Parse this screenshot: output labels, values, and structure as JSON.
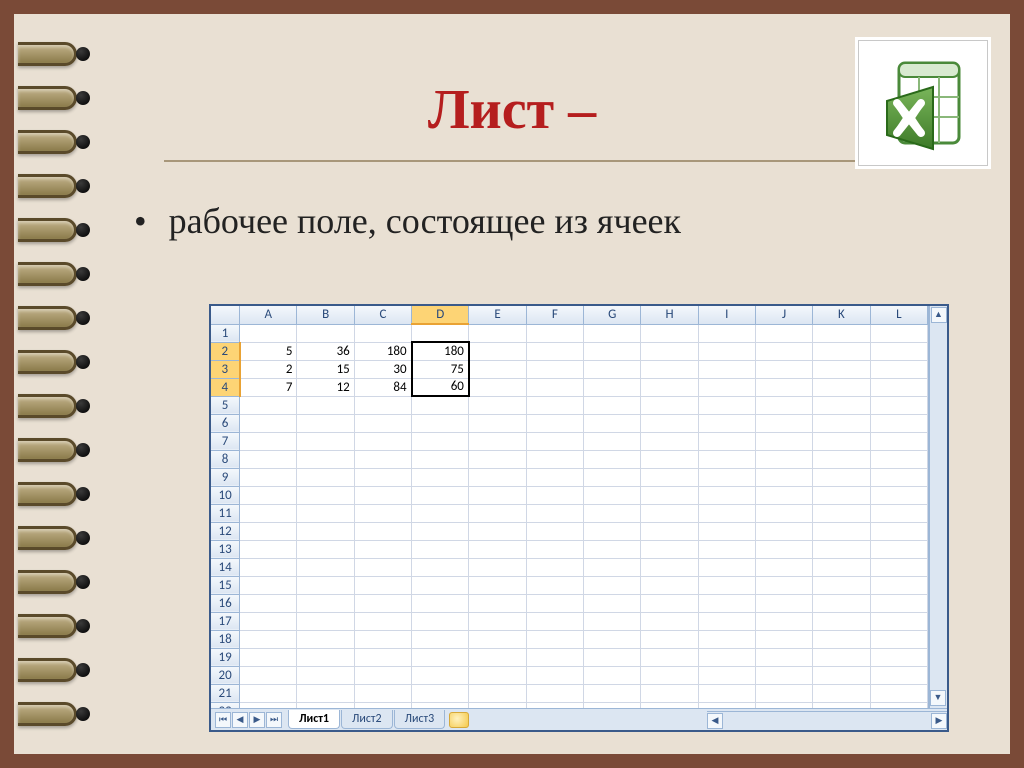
{
  "title": "Лист –",
  "bullet": "рабочее поле, состоящее из ячеек",
  "spreadsheet": {
    "columns": [
      "A",
      "B",
      "C",
      "D",
      "E",
      "F",
      "G",
      "H",
      "I",
      "J",
      "K",
      "L"
    ],
    "selected_column": "D",
    "selected_rows": [
      2,
      3,
      4
    ],
    "num_rows": 22,
    "data": {
      "2": {
        "A": "5",
        "B": "36",
        "C": "180",
        "D": "180"
      },
      "3": {
        "A": "2",
        "B": "15",
        "C": "30",
        "D": "75"
      },
      "4": {
        "A": "7",
        "B": "12",
        "C": "84",
        "D": "60"
      }
    },
    "tabs": [
      "Лист1",
      "Лист2",
      "Лист3"
    ],
    "active_tab": "Лист1"
  },
  "icons": {
    "nav_first": "⏮",
    "nav_prev": "◀",
    "nav_next": "▶",
    "nav_last": "⏭",
    "scroll_up": "▲",
    "scroll_down": "▼",
    "scroll_left": "◀",
    "scroll_right": "▶"
  }
}
